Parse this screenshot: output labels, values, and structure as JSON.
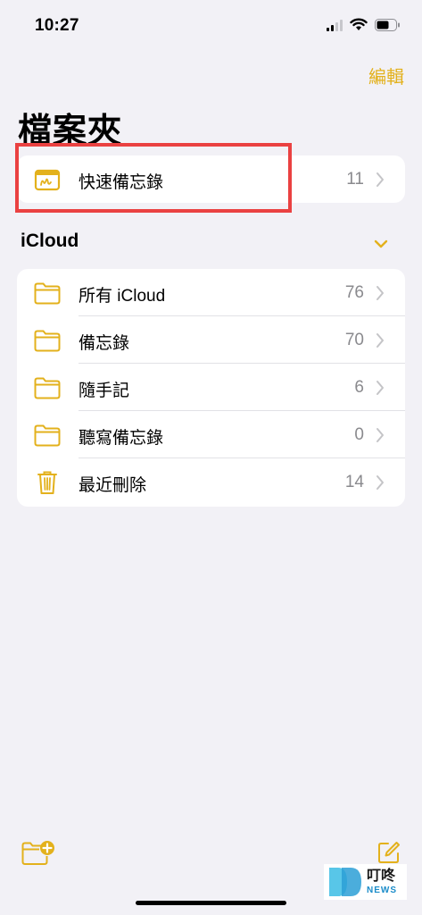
{
  "status_bar": {
    "time": "10:27"
  },
  "header": {
    "edit_label": "編輯",
    "title": "檔案夾"
  },
  "quick_note": {
    "label": "快速備忘錄",
    "count": "11"
  },
  "icloud": {
    "title": "iCloud",
    "folders": [
      {
        "label": "所有 iCloud",
        "count": "76",
        "icon": "folder-icon"
      },
      {
        "label": "備忘錄",
        "count": "70",
        "icon": "folder-icon"
      },
      {
        "label": "隨手記",
        "count": "6",
        "icon": "folder-icon"
      },
      {
        "label": "聽寫備忘錄",
        "count": "0",
        "icon": "folder-icon"
      },
      {
        "label": "最近刪除",
        "count": "14",
        "icon": "trash-icon"
      }
    ]
  },
  "watermark": {
    "cn": "叮咚",
    "en": "NEWS"
  },
  "colors": {
    "accent": "#e3b11c",
    "highlight": "#ea4141",
    "background": "#f2f1f6"
  }
}
